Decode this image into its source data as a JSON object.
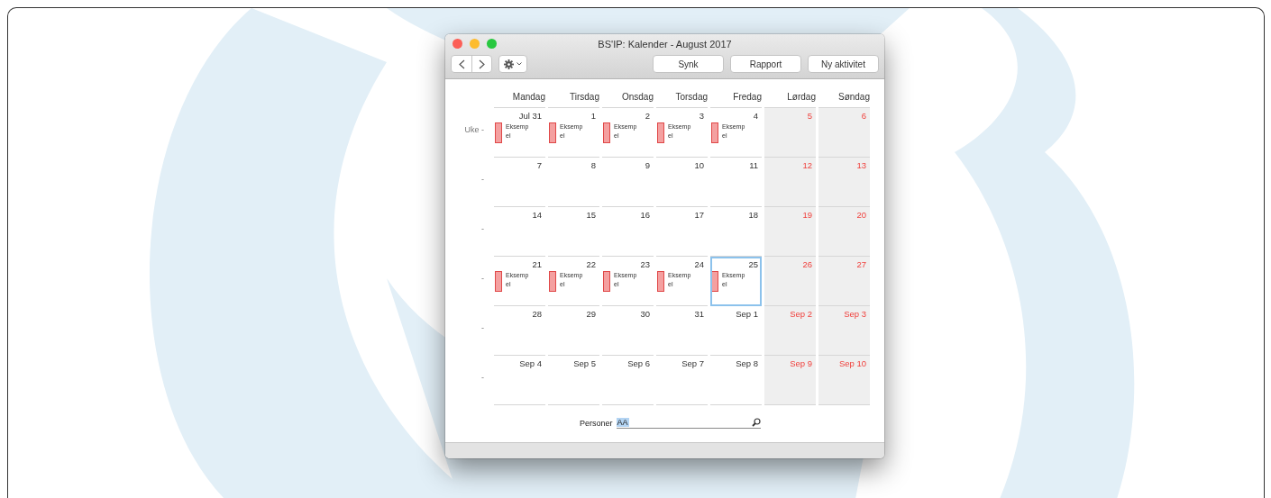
{
  "window": {
    "title": "BS'IP: Kalender - August 2017"
  },
  "toolbar": {
    "buttons": [
      "Synk",
      "Rapport",
      "Ny aktivitet"
    ]
  },
  "weekdays": [
    {
      "label": "Mandag"
    },
    {
      "label": "Tirsdag"
    },
    {
      "label": "Onsdag"
    },
    {
      "label": "Torsdag"
    },
    {
      "label": "Fredag"
    },
    {
      "label": "Lørdag"
    },
    {
      "label": "Søndag"
    }
  ],
  "weeks": [
    {
      "label": "Uke -",
      "days": [
        {
          "date": "Jul 31",
          "weekend": false,
          "selected": false,
          "events": [
            "Eksempel"
          ]
        },
        {
          "date": "1",
          "weekend": false,
          "selected": false,
          "events": [
            "Eksempel"
          ]
        },
        {
          "date": "2",
          "weekend": false,
          "selected": false,
          "events": [
            "Eksempel"
          ]
        },
        {
          "date": "3",
          "weekend": false,
          "selected": false,
          "events": [
            "Eksempel"
          ]
        },
        {
          "date": "4",
          "weekend": false,
          "selected": false,
          "events": [
            "Eksempel"
          ]
        },
        {
          "date": "5",
          "weekend": true,
          "selected": false
        },
        {
          "date": "6",
          "weekend": true,
          "selected": false
        }
      ]
    },
    {
      "label": "-",
      "days": [
        {
          "date": "7",
          "weekend": false,
          "selected": false
        },
        {
          "date": "8",
          "weekend": false,
          "selected": false
        },
        {
          "date": "9",
          "weekend": false,
          "selected": false
        },
        {
          "date": "10",
          "weekend": false,
          "selected": false
        },
        {
          "date": "11",
          "weekend": false,
          "selected": false
        },
        {
          "date": "12",
          "weekend": true,
          "selected": false
        },
        {
          "date": "13",
          "weekend": true,
          "selected": false
        }
      ]
    },
    {
      "label": "-",
      "days": [
        {
          "date": "14",
          "weekend": false,
          "selected": false
        },
        {
          "date": "15",
          "weekend": false,
          "selected": false
        },
        {
          "date": "16",
          "weekend": false,
          "selected": false
        },
        {
          "date": "17",
          "weekend": false,
          "selected": false
        },
        {
          "date": "18",
          "weekend": false,
          "selected": false
        },
        {
          "date": "19",
          "weekend": true,
          "selected": false
        },
        {
          "date": "20",
          "weekend": true,
          "selected": false
        }
      ]
    },
    {
      "label": "-",
      "days": [
        {
          "date": "21",
          "weekend": false,
          "selected": false,
          "events": [
            "Eksempel"
          ]
        },
        {
          "date": "22",
          "weekend": false,
          "selected": false,
          "events": [
            "Eksempel"
          ]
        },
        {
          "date": "23",
          "weekend": false,
          "selected": false,
          "events": [
            "Eksempel"
          ]
        },
        {
          "date": "24",
          "weekend": false,
          "selected": false,
          "events": [
            "Eksempel"
          ]
        },
        {
          "date": "25",
          "weekend": false,
          "selected": true,
          "events": [
            "Eksempel"
          ]
        },
        {
          "date": "26",
          "weekend": true,
          "selected": false
        },
        {
          "date": "27",
          "weekend": true,
          "selected": false
        }
      ]
    },
    {
      "label": "-",
      "days": [
        {
          "date": "28",
          "weekend": false,
          "selected": false
        },
        {
          "date": "29",
          "weekend": false,
          "selected": false
        },
        {
          "date": "30",
          "weekend": false,
          "selected": false
        },
        {
          "date": "31",
          "weekend": false,
          "selected": false
        },
        {
          "date": "Sep 1",
          "weekend": false,
          "selected": false
        },
        {
          "date": "Sep 2",
          "weekend": true,
          "selected": false
        },
        {
          "date": "Sep 3",
          "weekend": true,
          "selected": false
        }
      ]
    },
    {
      "label": "-",
      "days": [
        {
          "date": "Sep 4",
          "weekend": false,
          "selected": false
        },
        {
          "date": "Sep 5",
          "weekend": false,
          "selected": false
        },
        {
          "date": "Sep 6",
          "weekend": false,
          "selected": false
        },
        {
          "date": "Sep 7",
          "weekend": false,
          "selected": false
        },
        {
          "date": "Sep 8",
          "weekend": false,
          "selected": false
        },
        {
          "date": "Sep 9",
          "weekend": true,
          "selected": false
        },
        {
          "date": "Sep 10",
          "weekend": true,
          "selected": false
        }
      ]
    }
  ],
  "persons": {
    "label": "Personer",
    "value": "AA"
  }
}
